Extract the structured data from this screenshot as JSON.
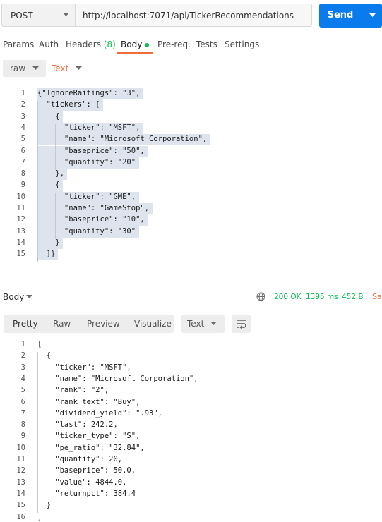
{
  "request": {
    "method": "POST",
    "url": "http://localhost:7071/api/TickerRecommendations",
    "send_label": "Send"
  },
  "tabs": [
    {
      "label": "Params"
    },
    {
      "label": "Auth"
    },
    {
      "label": "Headers",
      "count": "(8)"
    },
    {
      "label": "Body",
      "active": true
    },
    {
      "label": "Pre-req."
    },
    {
      "label": "Tests"
    },
    {
      "label": "Settings"
    }
  ],
  "body_options": {
    "mode": "raw",
    "format": "Text"
  },
  "request_body": {
    "line_numbers": [
      "1",
      "2",
      "3",
      "4",
      "5",
      "6",
      "7",
      "8",
      "9",
      "10",
      "11",
      "12",
      "13",
      "14",
      "15"
    ],
    "lines": [
      "{\"IgnoreRaitings\": \"3\",",
      "  \"tickers\": [",
      "    {",
      "      \"ticker\": \"MSFT\",",
      "      \"name\": \"Microsoft Corporation\",",
      "      \"baseprice\": \"50\",",
      "      \"quantity\": \"20\"",
      "    },",
      "    {",
      "      \"ticker\": \"GME\",",
      "      \"name\": \"GameStop\",",
      "      \"baseprice\": \"10\",",
      "      \"quantity\": \"30\"",
      "    }",
      "  ]}"
    ]
  },
  "response": {
    "section_label": "Body",
    "status": "200 OK",
    "time": "1395 ms",
    "size": "452 B",
    "save_label": "Sa",
    "view_tabs": [
      "Pretty",
      "Raw",
      "Preview",
      "Visualize"
    ],
    "format": "Text",
    "line_numbers": [
      "1",
      "2",
      "3",
      "4",
      "5",
      "6",
      "7",
      "8",
      "9",
      "10",
      "11",
      "12",
      "13",
      "14",
      "15",
      "16"
    ],
    "lines": [
      "[",
      "  {",
      "    \"ticker\": \"MSFT\",",
      "    \"name\": \"Microsoft Corporation\",",
      "    \"rank\": \"2\",",
      "    \"rank_text\": \"Buy\",",
      "    \"dividend_yield\": \".93\",",
      "    \"last\": 242.2,",
      "    \"ticker_type\": \"S\",",
      "    \"pe_ratio\": \"32.84\",",
      "    \"quantity\": 20,",
      "    \"baseprice\": 50.0,",
      "    \"value\": 4844.0,",
      "    \"returnpct\": 384.4",
      "  }",
      "]"
    ]
  },
  "colors": {
    "accent_blue": "#097bed",
    "accent_orange": "#f26b3a",
    "status_green": "#0cbb52"
  }
}
